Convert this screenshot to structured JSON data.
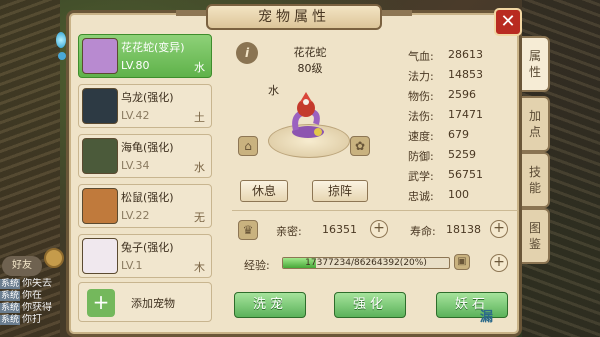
{
  "window": {
    "title": "宠物属性",
    "close_label": "✕"
  },
  "tabs": [
    {
      "label": "属性",
      "active": true
    },
    {
      "label": "加点",
      "active": false
    },
    {
      "label": "技能",
      "active": false
    },
    {
      "label": "图鉴",
      "active": false
    }
  ],
  "pets": [
    {
      "name": "花花蛇(变异)",
      "level": "LV.80",
      "element": "水",
      "active": true,
      "color": "#b88ad0"
    },
    {
      "name": "乌龙(强化)",
      "level": "LV.42",
      "element": "土",
      "active": false,
      "color": "#2d3a44"
    },
    {
      "name": "海龟(强化)",
      "level": "LV.34",
      "element": "水",
      "active": false,
      "color": "#4b5a3a"
    },
    {
      "name": "松鼠(强化)",
      "level": "LV.22",
      "element": "无",
      "active": false,
      "color": "#c07a3c"
    },
    {
      "name": "兔子(强化)",
      "level": "LV.1",
      "element": "木",
      "active": false,
      "color": "#f0e8ee"
    }
  ],
  "add_pet_label": "添加宠物",
  "selected": {
    "name": "花花蛇",
    "level": "80级",
    "element": "水"
  },
  "buttons": {
    "rest": "休息",
    "battle": "掠阵",
    "wash": "洗宠",
    "strengthen": "强化",
    "stone": "妖石"
  },
  "stats": [
    {
      "k": "气血:",
      "v": "28613"
    },
    {
      "k": "法力:",
      "v": "14853"
    },
    {
      "k": "物伤:",
      "v": "2596"
    },
    {
      "k": "法伤:",
      "v": "17471"
    },
    {
      "k": "速度:",
      "v": "679"
    },
    {
      "k": "防御:",
      "v": "5259"
    },
    {
      "k": "武学:",
      "v": "56751"
    },
    {
      "k": "忠诚:",
      "v": "100"
    }
  ],
  "intimacy": {
    "label": "亲密:",
    "value": "16351"
  },
  "lifespan": {
    "label": "寿命:",
    "value": "18138"
  },
  "exp": {
    "label": "经验:",
    "text": "17377234/86264392(20%)",
    "percent": 20
  },
  "chat": {
    "friend_label": "好友",
    "lines": [
      {
        "tag": "系统",
        "text": "你失去"
      },
      {
        "tag": "系统",
        "text": "你在"
      },
      {
        "tag": "系统",
        "text": "你获得"
      },
      {
        "tag": "系统",
        "text": "你打"
      }
    ]
  },
  "watermark": "漏"
}
